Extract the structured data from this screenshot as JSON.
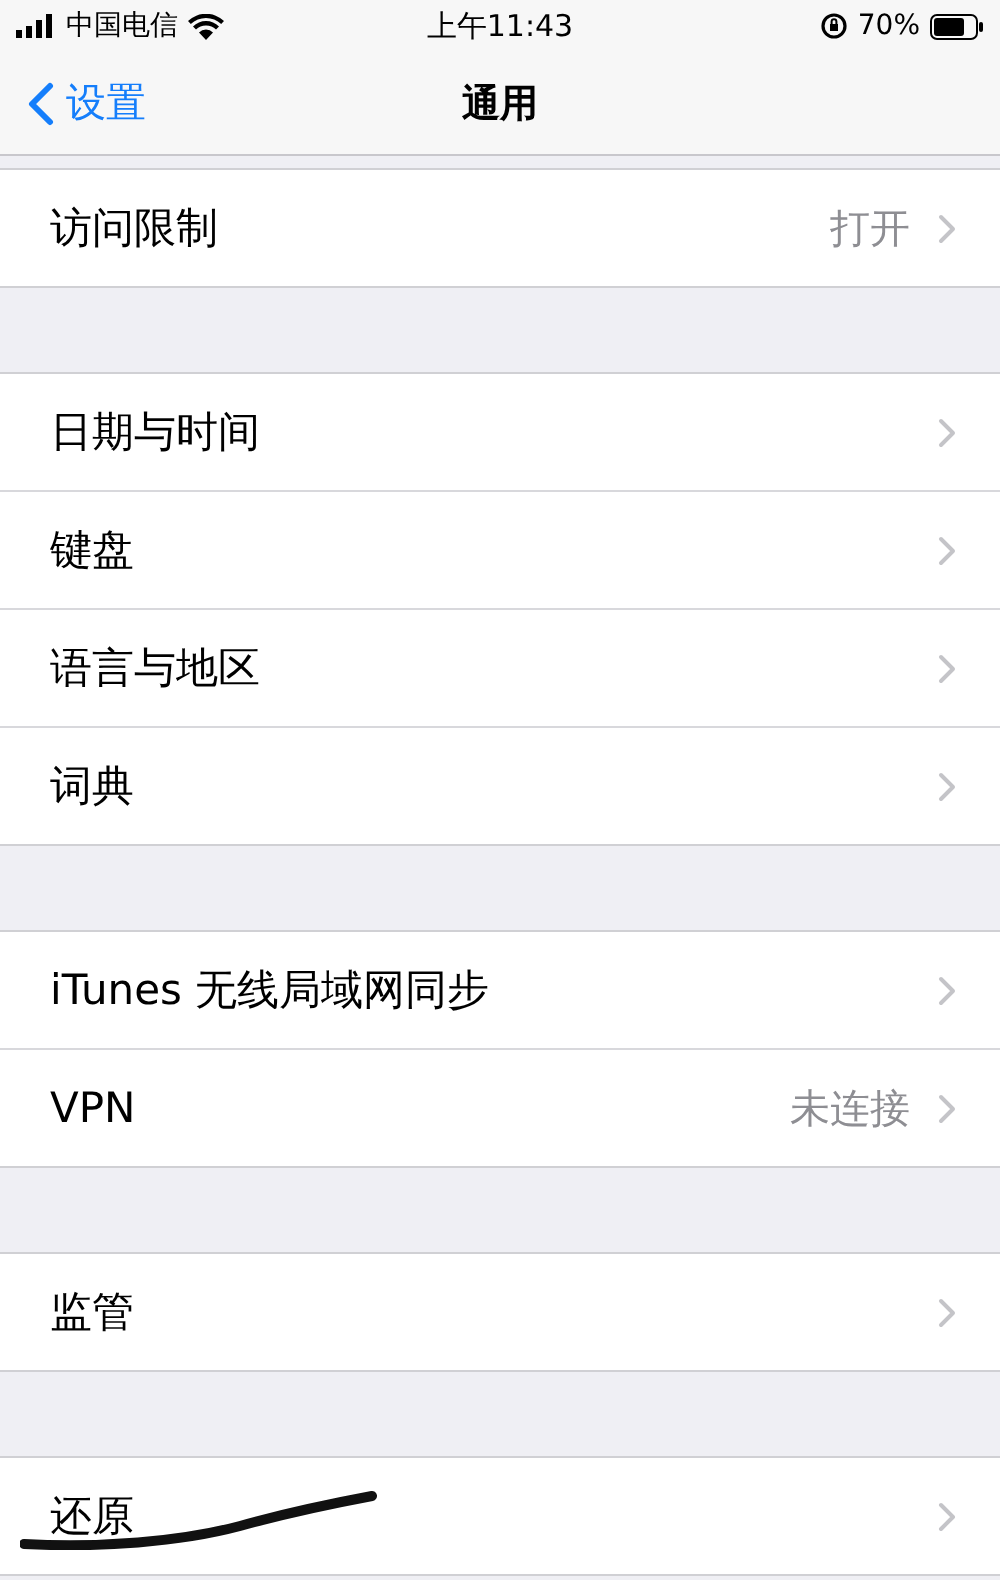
{
  "status_bar": {
    "carrier": "中国电信",
    "time": "上午11:43",
    "battery": "70%"
  },
  "nav_bar": {
    "back": "设置",
    "title": "通用"
  },
  "sections": [
    {
      "rows": [
        {
          "label": "访问限制",
          "detail": "打开"
        }
      ]
    },
    {
      "rows": [
        {
          "label": "日期与时间"
        },
        {
          "label": "键盘"
        },
        {
          "label": "语言与地区"
        },
        {
          "label": "词典"
        }
      ]
    },
    {
      "rows": [
        {
          "label": "iTunes 无线局域网同步"
        },
        {
          "label": "VPN",
          "detail": "未连接"
        }
      ]
    },
    {
      "rows": [
        {
          "label": "监管"
        }
      ]
    },
    {
      "rows": [
        {
          "label": "还原"
        }
      ]
    }
  ]
}
